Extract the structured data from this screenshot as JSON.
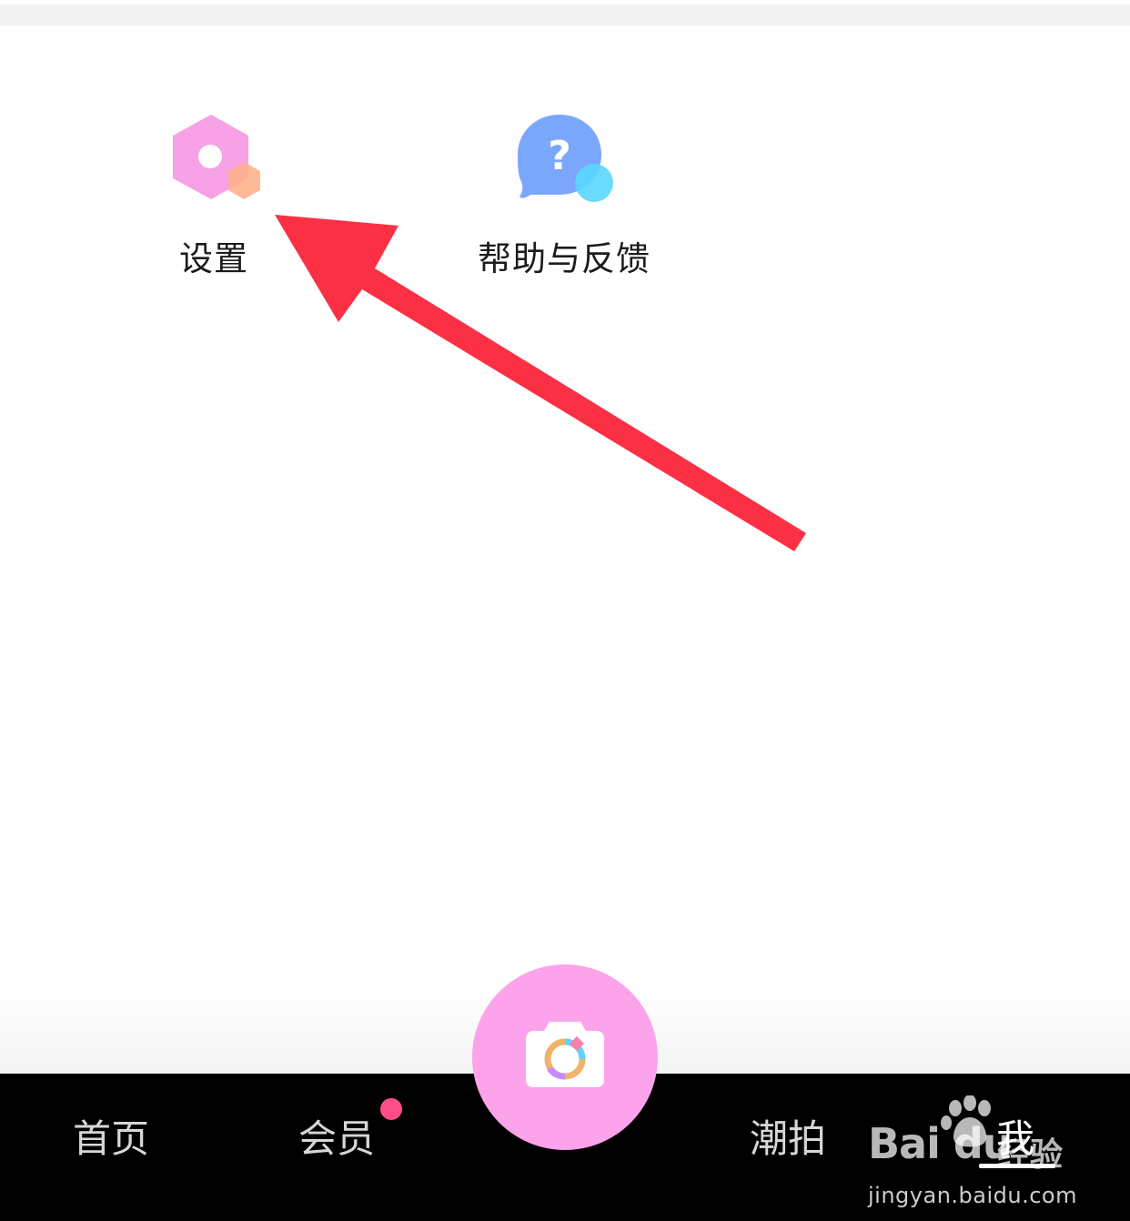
{
  "grid": {
    "settings": {
      "label": "设置",
      "icon": "settings-hexagon-icon",
      "color": "#f7a1e6",
      "accent": "#ffb98f"
    },
    "help": {
      "label": "帮助与反馈",
      "icon": "help-chat-bubble-icon",
      "color": "#7aa7fb",
      "accent": "#5cd6ff"
    }
  },
  "annotation": {
    "type": "arrow",
    "color": "#fc3045"
  },
  "tabbar": {
    "home": "首页",
    "vip": "会员",
    "trend": "潮拍",
    "me": "我",
    "camera_color": "#fca3ec",
    "vip_badge_color": "#ff4d8a"
  },
  "watermark": {
    "brand": "Bai du",
    "brand_cn": "经验",
    "url": "jingyan.baidu.com"
  }
}
